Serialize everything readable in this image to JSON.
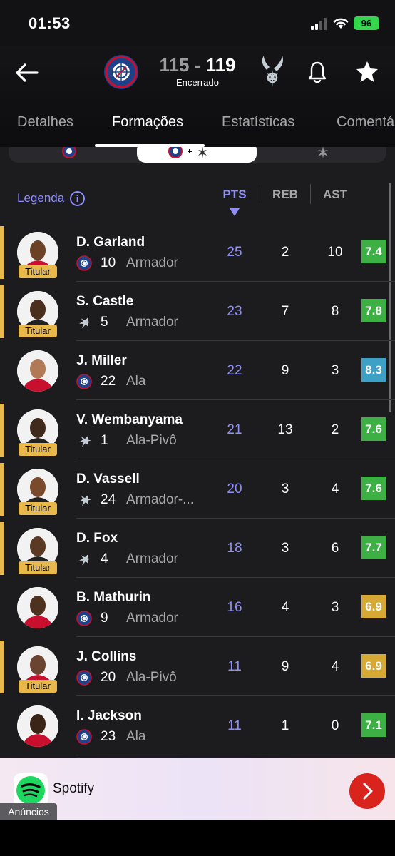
{
  "status_bar": {
    "time": "01:53",
    "battery": "96"
  },
  "match": {
    "home_score": "115",
    "separator": "-",
    "away_score": "119",
    "status": "Encerrado",
    "home_team": "LOS ANGELES CLIPPERS"
  },
  "tabs": [
    "Detalhes",
    "Formações",
    "Estatísticas",
    "Comentá"
  ],
  "legend": {
    "label": "Legenda",
    "info_icon": "i"
  },
  "columns": {
    "pts": "PTS",
    "reb": "REB",
    "ast": "AST"
  },
  "players": [
    {
      "name": "D. Garland",
      "number": "10",
      "position": "Armador",
      "team": "clippers",
      "pts": "25",
      "reb": "2",
      "ast": "10",
      "rating": "7.4",
      "rating_color": "#3cb043",
      "starter": true
    },
    {
      "name": "S. Castle",
      "number": "5",
      "position": "Armador",
      "team": "spurs",
      "pts": "23",
      "reb": "7",
      "ast": "8",
      "rating": "7.8",
      "rating_color": "#3cb043",
      "starter": true
    },
    {
      "name": "J. Miller",
      "number": "22",
      "position": "Ala",
      "team": "clippers",
      "pts": "22",
      "reb": "9",
      "ast": "3",
      "rating": "8.3",
      "rating_color": "#3ea0c4",
      "starter": false
    },
    {
      "name": "V. Wembanyama",
      "number": "1",
      "position": "Ala-Pivô",
      "team": "spurs",
      "pts": "21",
      "reb": "13",
      "ast": "2",
      "rating": "7.6",
      "rating_color": "#3cb043",
      "starter": true
    },
    {
      "name": "D. Vassell",
      "number": "24",
      "position": "Armador-...",
      "team": "spurs",
      "pts": "20",
      "reb": "3",
      "ast": "4",
      "rating": "7.6",
      "rating_color": "#3cb043",
      "starter": true
    },
    {
      "name": "D. Fox",
      "number": "4",
      "position": "Armador",
      "team": "spurs",
      "pts": "18",
      "reb": "3",
      "ast": "6",
      "rating": "7.7",
      "rating_color": "#3cb043",
      "starter": true
    },
    {
      "name": "B. Mathurin",
      "number": "9",
      "position": "Armador",
      "team": "clippers",
      "pts": "16",
      "reb": "4",
      "ast": "3",
      "rating": "6.9",
      "rating_color": "#d6a834",
      "starter": false
    },
    {
      "name": "J. Collins",
      "number": "20",
      "position": "Ala-Pivô",
      "team": "clippers",
      "pts": "11",
      "reb": "9",
      "ast": "4",
      "rating": "6.9",
      "rating_color": "#d6a834",
      "starter": true
    },
    {
      "name": "I. Jackson",
      "number": "23",
      "position": "Ala",
      "team": "clippers",
      "pts": "11",
      "reb": "1",
      "ast": "0",
      "rating": "7.1",
      "rating_color": "#3cb043",
      "starter": false
    }
  ],
  "starter_label": "Titular",
  "ad": {
    "brand": "Spotify",
    "label": "Anúncios"
  },
  "colors": {
    "accent": "#8f8ff7",
    "starter": "#e8b84a"
  }
}
